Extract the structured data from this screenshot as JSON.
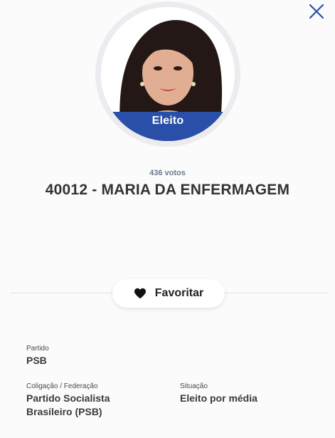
{
  "status": {
    "badge": "Eleito",
    "badge_color": "#2a4fa8"
  },
  "candidate": {
    "votes": "436 votos",
    "name": "40012 - MARIA DA ENFERMAGEM"
  },
  "actions": {
    "favorite_label": "Favoritar",
    "favorite_icon": "heart-icon",
    "close_icon": "close-icon"
  },
  "info": {
    "partido_label": "Partido",
    "partido_value": "PSB",
    "coligacao_label": "Coligação / Federação",
    "coligacao_value_line1": "Partido Socialista",
    "coligacao_value_line2": "Brasileiro (PSB)",
    "situacao_label": "Situação",
    "situacao_value": "Eleito por média"
  },
  "colors": {
    "accent": "#2a4fa8",
    "close": "#2a4fa8",
    "text_dark": "#333333",
    "votes": "#6b7a90"
  }
}
